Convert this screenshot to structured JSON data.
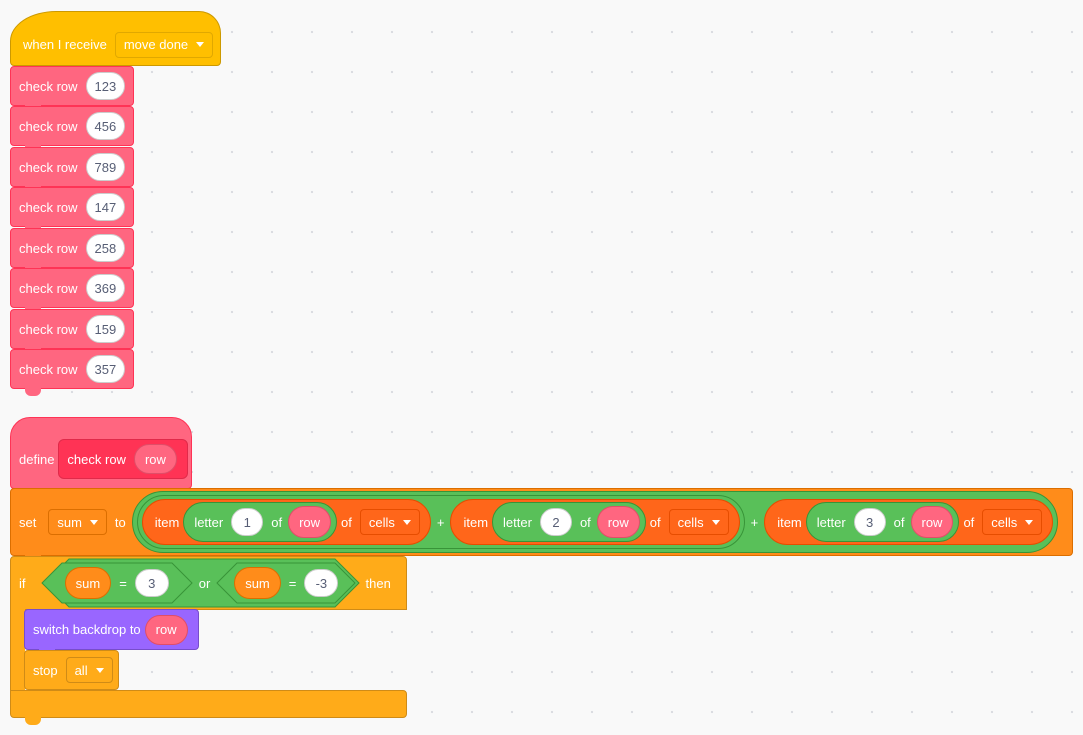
{
  "event_hat": {
    "label": "when I receive",
    "message": "move done"
  },
  "check_calls": {
    "label": "check row",
    "args": [
      "123",
      "456",
      "789",
      "147",
      "258",
      "369",
      "159",
      "357"
    ]
  },
  "define_block": {
    "define": "define",
    "proc_label": "check row",
    "param": "row"
  },
  "set_block": {
    "set": "set",
    "var": "sum",
    "to": "to",
    "plus": "+",
    "terms": [
      {
        "item": "item",
        "letter": "letter",
        "index": "1",
        "of1": "of",
        "param": "row",
        "of2": "of",
        "list": "cells"
      },
      {
        "item": "item",
        "letter": "letter",
        "index": "2",
        "of1": "of",
        "param": "row",
        "of2": "of",
        "list": "cells"
      },
      {
        "item": "item",
        "letter": "letter",
        "index": "3",
        "of1": "of",
        "param": "row",
        "of2": "of",
        "list": "cells"
      }
    ]
  },
  "if_block": {
    "if": "if",
    "then": "then",
    "or": "or",
    "cond1": {
      "var": "sum",
      "eq": "=",
      "value": "3"
    },
    "cond2": {
      "var": "sum",
      "eq": "=",
      "value": "-3"
    }
  },
  "switch_block": {
    "label": "switch backdrop to",
    "param": "row"
  },
  "stop_block": {
    "label": "stop",
    "option": "all"
  },
  "colors": {
    "events": "#ffbf00",
    "control": "#ffab19",
    "my_blocks": "#ff6680",
    "variables": "#ff8c1a",
    "operators": "#59c059",
    "lists": "#ff661a",
    "looks": "#9966ff"
  }
}
